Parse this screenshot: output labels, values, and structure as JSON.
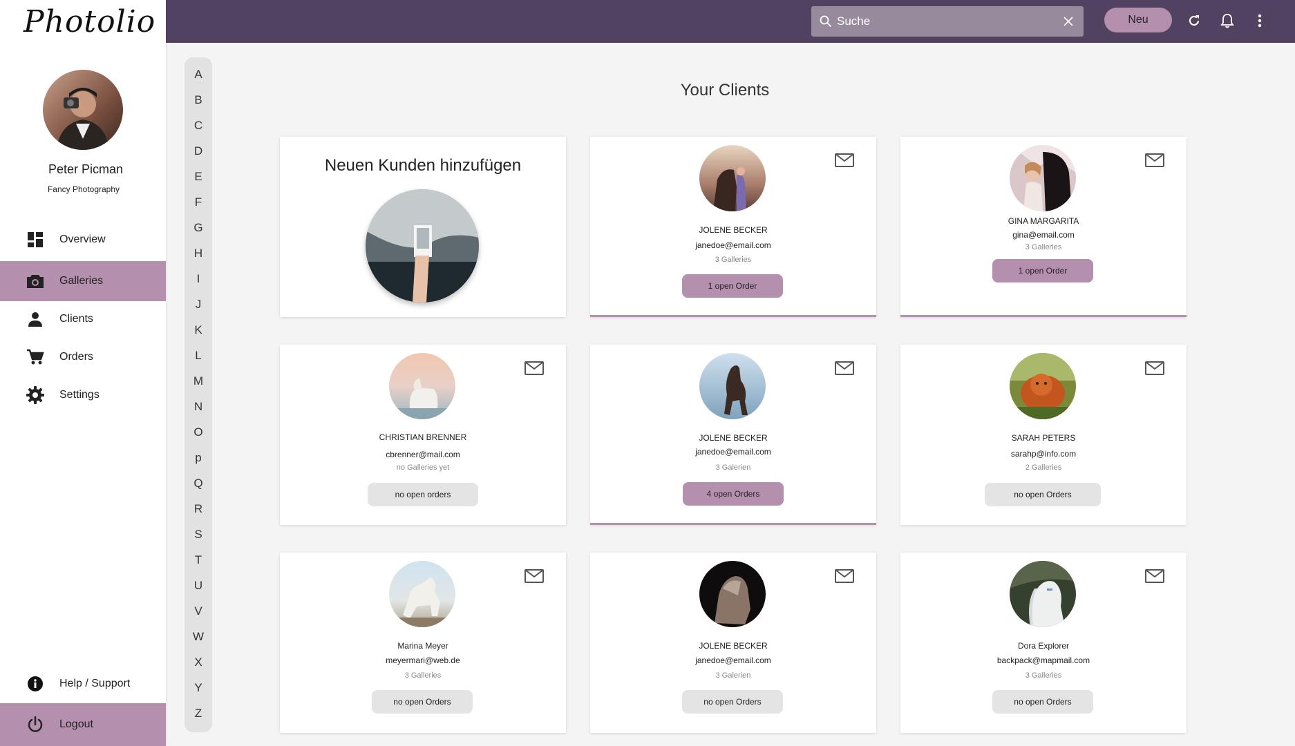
{
  "app": {
    "logo": "Photolio"
  },
  "profile": {
    "name": "Peter Picman",
    "subtitle": "Fancy Photography"
  },
  "nav": {
    "items": [
      {
        "label": "Overview",
        "icon": "dashboard-icon",
        "active": false
      },
      {
        "label": "Galleries",
        "icon": "camera-icon",
        "active": true
      },
      {
        "label": "Clients",
        "icon": "person-icon",
        "active": false
      },
      {
        "label": "Orders",
        "icon": "cart-icon",
        "active": false
      },
      {
        "label": "Settings",
        "icon": "gear-icon",
        "active": false
      }
    ],
    "help": "Help / Support",
    "logout": "Logout"
  },
  "topbar": {
    "search_text": "Suche",
    "new_label": "Neu",
    "icons": [
      "refresh-icon",
      "bell-icon",
      "more-vert-icon"
    ]
  },
  "alphabet": [
    "A",
    "B",
    "C",
    "D",
    "E",
    "F",
    "G",
    "H",
    "I",
    "J",
    "K",
    "L",
    "M",
    "N",
    "O",
    "p",
    "Q",
    "R",
    "S",
    "T",
    "U",
    "V",
    "W",
    "X",
    "Y",
    "Z"
  ],
  "main": {
    "heading": "Your Clients",
    "add_card_title": "Neuen Kunden hinzufügen",
    "clients": [
      {
        "name": "JOLENE BECKER",
        "email": "janedoe@email.com",
        "galleries": "3 Galleries",
        "orders": "1 open Order",
        "open": true
      },
      {
        "name": "GINA MARGARITA",
        "email": "gina@email.com",
        "galleries": "3 Galleries",
        "orders": "1 open Order",
        "open": true
      },
      {
        "name": "CHRISTIAN BRENNER",
        "email": "cbrenner@mail.com",
        "galleries": "no Galleries yet",
        "orders": "no open orders",
        "open": false
      },
      {
        "name": "JOLENE BECKER",
        "email": "janedoe@email.com",
        "galleries": "3 Galerien",
        "orders": "4 open Orders",
        "open": true
      },
      {
        "name": "SARAH PETERS",
        "email": "sarahp@info.com",
        "galleries": "2 Galleries",
        "orders": "no open Orders",
        "open": false
      },
      {
        "name": "Marina Meyer",
        "email": "meyermari@web.de",
        "galleries": "3 Galleries",
        "orders": "no open Orders",
        "open": false
      },
      {
        "name": "JOLENE BECKER",
        "email": "janedoe@email.com",
        "galleries": "3 Galerien",
        "orders": "no open Orders",
        "open": false
      },
      {
        "name": "Dora Explorer",
        "email": "backpack@mapmail.com",
        "galleries": "3 Galleries",
        "orders": "no open Orders",
        "open": false
      }
    ]
  },
  "colors": {
    "topbar": "#514261",
    "accent": "#b48fae",
    "search_bg": "#968a9c",
    "neutral_button": "#e4e4e4"
  }
}
